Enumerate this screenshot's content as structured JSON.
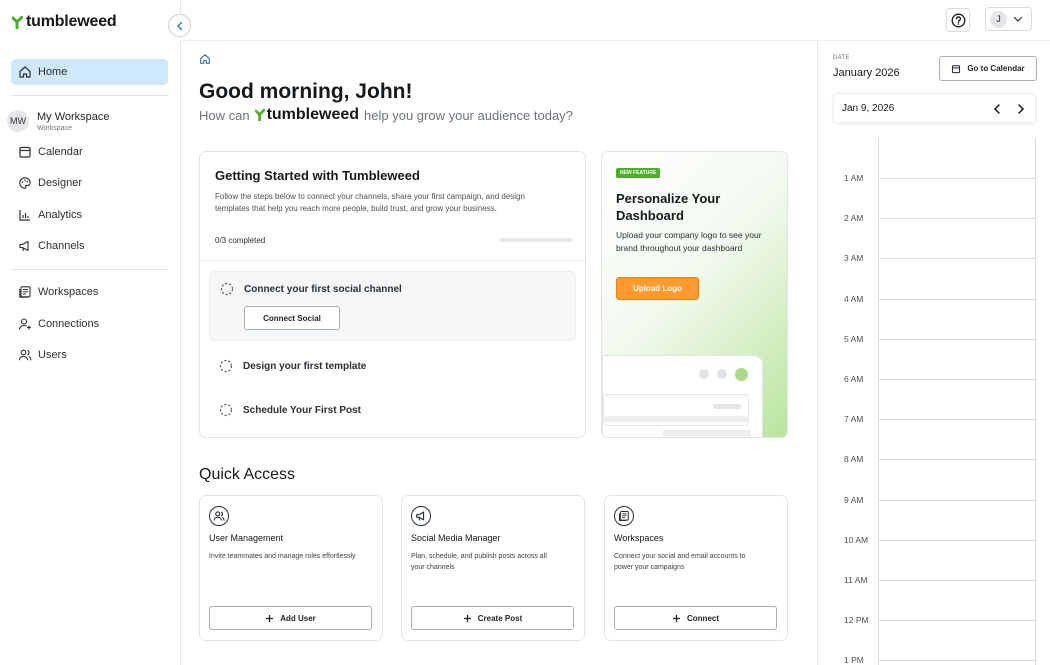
{
  "brand": {
    "name": "tumbleweed",
    "accent": "#4caf2a"
  },
  "sidebar": {
    "items": [
      {
        "label": "Home",
        "icon": "home-icon",
        "active": true
      },
      {
        "label": "Calendar",
        "icon": "calendar-icon"
      },
      {
        "label": "Designer",
        "icon": "palette-icon"
      },
      {
        "label": "Analytics",
        "icon": "analytics-icon"
      },
      {
        "label": "Channels",
        "icon": "megaphone-icon"
      },
      {
        "label": "Workspaces",
        "icon": "workspaces-icon"
      },
      {
        "label": "Connections",
        "icon": "user-plus-icon"
      },
      {
        "label": "Users",
        "icon": "users-icon"
      }
    ],
    "workspace": {
      "initials": "MW",
      "name": "My Workspace",
      "sub": "Workspace"
    }
  },
  "topbar": {
    "user_initial": "J"
  },
  "main": {
    "greeting": "Good morning, John!",
    "subtitle_before": "How can",
    "subtitle_brand": "tumbleweed",
    "subtitle_after": "help you grow your audience today?"
  },
  "getting_started": {
    "title": "Getting Started with Tumbleweed",
    "description": "Follow the steps below to connect your channels, share your first campaign, and design templates that help you reach more people, build trust, and grow your business.",
    "progress_text": "0/3 completed",
    "progress_fraction": 0,
    "steps": [
      {
        "label": "Connect your first social channel",
        "button": "Connect Social"
      },
      {
        "label": "Design your first template"
      },
      {
        "label": "Schedule Your First Post"
      }
    ]
  },
  "feature": {
    "badge": "NEW FEATURE",
    "title": "Personalize Your Dashboard",
    "description": "Upload your company logo to see your brand throughout your dashboard",
    "button": "Upload Logo",
    "button_color": "#ff9a2e"
  },
  "quick_access": {
    "title": "Quick Access",
    "cards": [
      {
        "name": "User Management",
        "description": "Invite teammates and manage roles effortlessly",
        "button": "Add User",
        "icon": "users-icon"
      },
      {
        "name": "Social Media Manager",
        "description": "Plan, schedule, and publish posts across all your channels",
        "button": "Create Post",
        "icon": "megaphone-icon"
      },
      {
        "name": "Workspaces",
        "description": "Connect your social and email accounts to power your campaigns",
        "button": "Connect",
        "icon": "workspaces-icon"
      }
    ]
  },
  "calendar": {
    "date_label": "DATE",
    "month": "January 2026",
    "goto_label": "Go to Calendar",
    "current_date": "Jan 9, 2026",
    "hours": [
      "1 AM",
      "2 AM",
      "3 AM",
      "4 AM",
      "5 AM",
      "6 AM",
      "7 AM",
      "8 AM",
      "9 AM",
      "10 AM",
      "11 AM",
      "12 PM",
      "1 PM"
    ]
  }
}
